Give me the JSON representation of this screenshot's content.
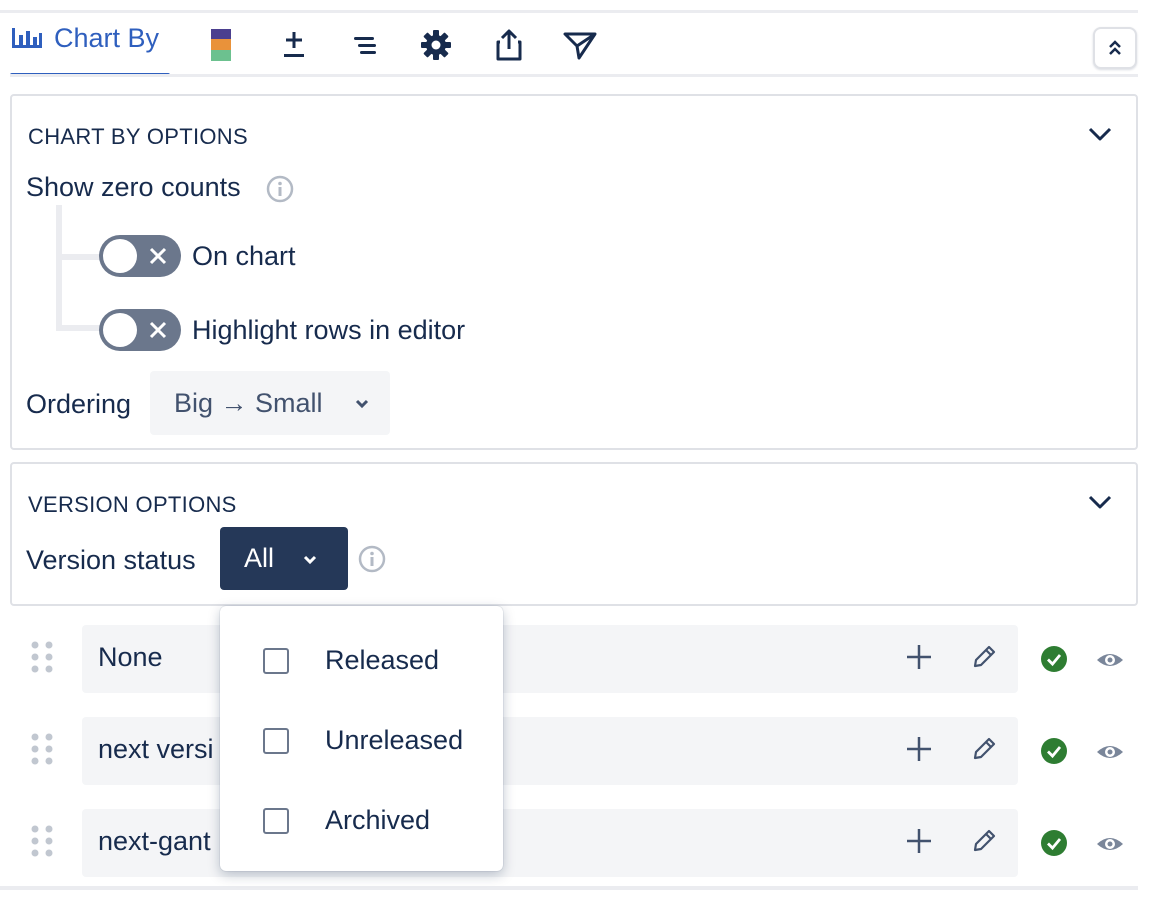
{
  "toolbar": {
    "active_tab": {
      "label": "Chart By",
      "icon": "bar-chart-icon"
    },
    "tools": [
      {
        "name": "color-scheme-icon"
      },
      {
        "name": "plus-minus-icon"
      },
      {
        "name": "sort-lines-icon"
      },
      {
        "name": "gear-icon"
      },
      {
        "name": "share-icon"
      },
      {
        "name": "send-icon"
      }
    ],
    "collapse": {
      "icon": "double-chevron-up-icon"
    }
  },
  "chart_by_options": {
    "title": "CHART BY OPTIONS",
    "show_zero_counts": {
      "label": "Show zero counts",
      "on_chart": {
        "label": "On chart",
        "enabled": false
      },
      "highlight_rows": {
        "label": "Highlight rows in editor",
        "enabled": false
      }
    },
    "ordering": {
      "label": "Ordering",
      "value": "Big → Small"
    }
  },
  "version_options": {
    "title": "VERSION OPTIONS",
    "version_status": {
      "label": "Version status",
      "value": "All"
    }
  },
  "rows": [
    {
      "name": "None"
    },
    {
      "name": "next versi"
    },
    {
      "name": "next-gant"
    }
  ],
  "status_dropdown": {
    "options": [
      {
        "label": "Released",
        "checked": false
      },
      {
        "label": "Unreleased",
        "checked": false
      },
      {
        "label": "Archived",
        "checked": false
      }
    ]
  },
  "colors": {
    "accent": "#2f5fbe",
    "dark_select": "#253858",
    "toggle_off": "#6b778c",
    "check_green": "#2e7d32"
  }
}
